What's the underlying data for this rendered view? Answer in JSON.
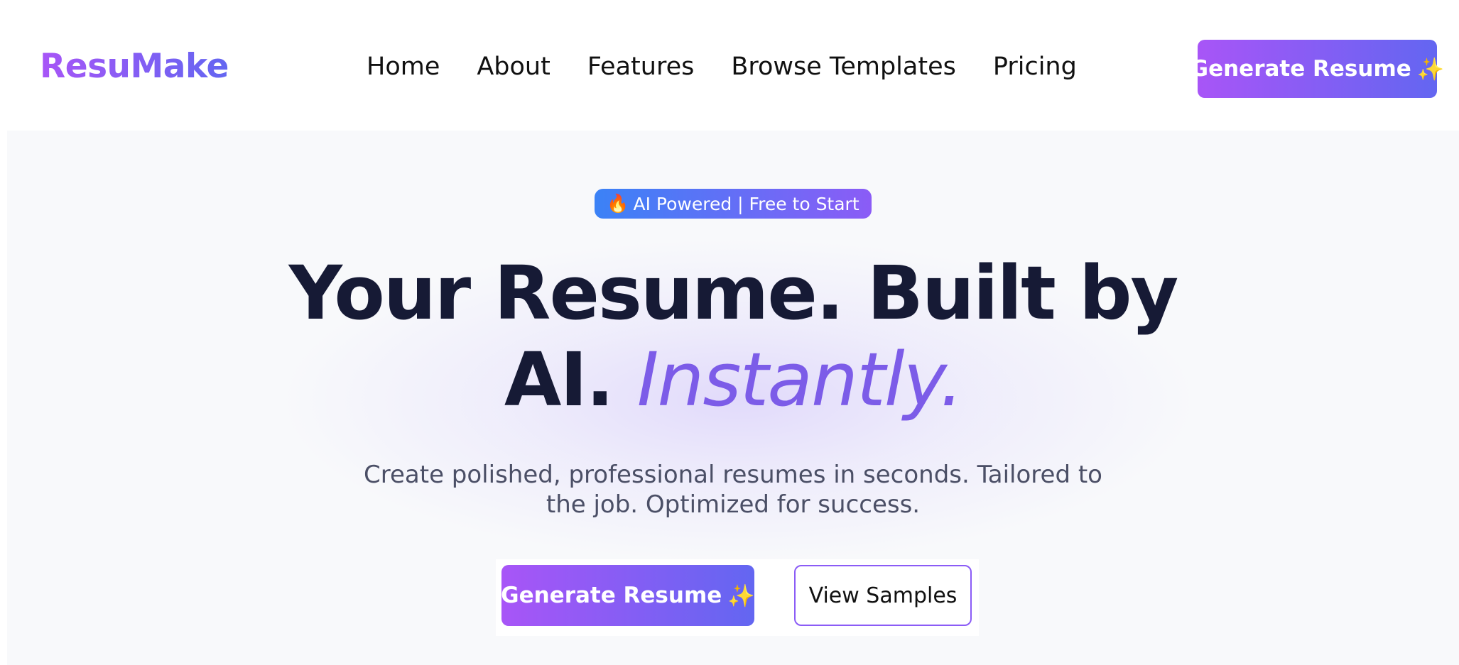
{
  "navbar": {
    "logo": "ResuMake",
    "links": [
      "Home",
      "About",
      "Features",
      "Browse Templates",
      "Pricing"
    ],
    "cta_label": "Generate Resume",
    "cta_icon": "✨"
  },
  "hero": {
    "badge_icon": "🔥",
    "badge_text": "AI Powered | Free to Start",
    "headline_line1": "Your Resume. Built by",
    "headline_line2_start": "AI.",
    "headline_accent": "Instantly.",
    "subtext": "Create polished, professional resumes in seconds. Tailored to the job. Optimized for success.",
    "primary_cta_label": "Generate Resume",
    "primary_cta_icon": "✨",
    "secondary_cta_label": "View Samples"
  },
  "colors": {
    "gradient_start": "#a855f7",
    "gradient_end": "#6366f1",
    "headline": "#161a35",
    "accent": "#7c5ce8",
    "hero_bg": "#f8f9fb"
  }
}
